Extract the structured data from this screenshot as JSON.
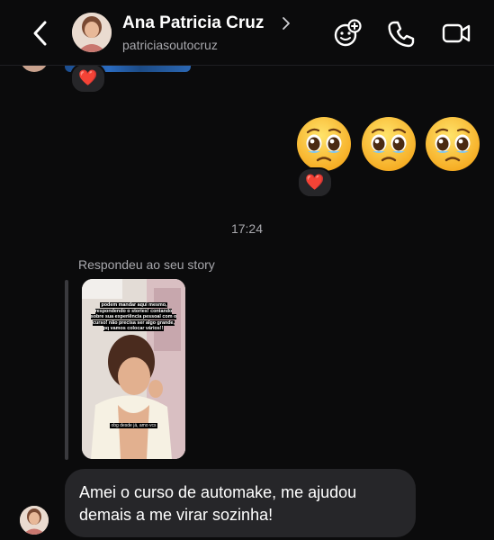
{
  "header": {
    "name": "Ana Patricia Cruz",
    "username": "patriciasoutocruz",
    "icons": [
      "back-icon",
      "chevron-right-icon",
      "effects-icon",
      "phone-icon",
      "video-icon"
    ]
  },
  "messages": {
    "partial_image_reaction": "❤️",
    "emoji_message": [
      "🥺",
      "🥺",
      "🥺"
    ],
    "emoji_reaction": "❤️",
    "timestamp": "17:24",
    "reply_label": "Respondeu ao seu story",
    "story": {
      "caption": "podem mandar aqui mesmo, respondendo o stories! contando sobre sua experiência pessoal com o curso! não precisa ser algo grande, pq vamos colocar vários!!",
      "bottom_text": "obg desde já, amo vcs"
    },
    "text_message": "Amei o curso de automake, me ajudou demais a me virar sozinha!"
  },
  "colors": {
    "background": "#0b0b0c",
    "bubble": "#262629",
    "secondary_text": "#a8a8ad"
  }
}
